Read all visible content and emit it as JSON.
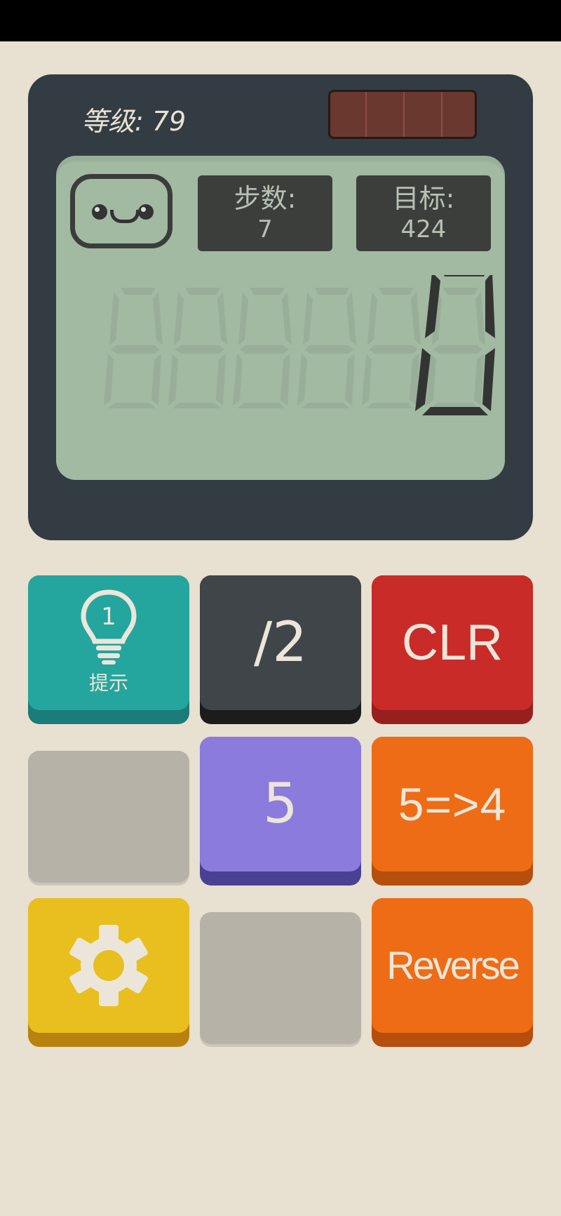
{
  "header": {
    "level_label": "等级: 79"
  },
  "screen": {
    "moves_label": "步数:",
    "moves_value": "7",
    "goal_label": "目标:",
    "goal_value": "424",
    "display_value": "0"
  },
  "keys": {
    "hint": {
      "label": "提示",
      "hint_count": "1"
    },
    "divide": {
      "label": "/2"
    },
    "clear": {
      "label": "CLR"
    },
    "five": {
      "label": "5"
    },
    "replace": {
      "label": "5=>4"
    },
    "reverse": {
      "label": "Reverse"
    }
  },
  "icons": {
    "hint": "lightbulb-icon",
    "settings": "gear-icon",
    "face": "smiley-face-icon"
  },
  "colors": {
    "hint_key": "#24a59e",
    "divide_key": "#3f4548",
    "clear_key": "#c92b28",
    "five_key": "#8b7bdc",
    "replace_key": "#ee6c15",
    "settings_key": "#e8bf1e",
    "reverse_key": "#ee6c15",
    "lcd": "#a2b9a2"
  }
}
